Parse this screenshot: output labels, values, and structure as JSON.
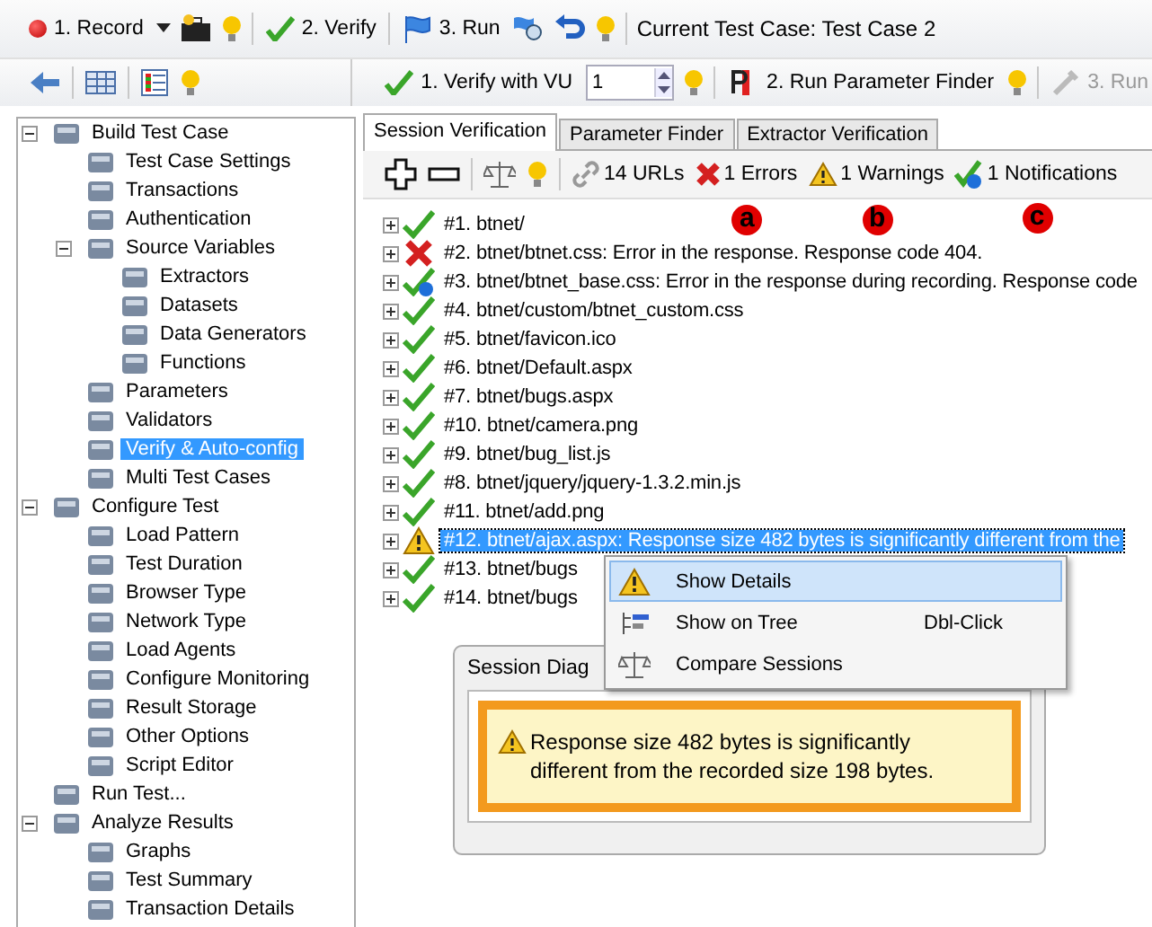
{
  "toolbar_top": {
    "record": "1. Record",
    "verify": "2. Verify",
    "run": "3. Run",
    "current_test_case": "Current Test Case: Test Case 2"
  },
  "toolbar_second": {
    "verify_vu": "1. Verify with VU",
    "vu_count": "1",
    "run_parameter_finder": "2. Run Parameter Finder",
    "run_disabled": "3. Run"
  },
  "sidebar": {
    "items": [
      {
        "label": "Build Test Case",
        "selected": false,
        "expanded": true,
        "children": [
          {
            "label": "Test Case Settings",
            "selected": false
          },
          {
            "label": "Transactions",
            "selected": false
          },
          {
            "label": "Authentication",
            "selected": false
          },
          {
            "label": "Source Variables",
            "selected": false,
            "expanded": true,
            "children": [
              {
                "label": "Extractors",
                "selected": false
              },
              {
                "label": "Datasets",
                "selected": false
              },
              {
                "label": "Data Generators",
                "selected": false
              },
              {
                "label": "Functions",
                "selected": false
              }
            ]
          },
          {
            "label": "Parameters",
            "selected": false
          },
          {
            "label": "Validators",
            "selected": false
          },
          {
            "label": "Verify & Auto-config",
            "selected": true
          },
          {
            "label": "Multi Test Cases",
            "selected": false
          }
        ]
      },
      {
        "label": "Configure Test",
        "selected": false,
        "expanded": true,
        "children": [
          {
            "label": "Load Pattern",
            "selected": false
          },
          {
            "label": "Test Duration",
            "selected": false
          },
          {
            "label": "Browser Type",
            "selected": false
          },
          {
            "label": "Network Type",
            "selected": false
          },
          {
            "label": "Load Agents",
            "selected": false
          },
          {
            "label": "Configure Monitoring",
            "selected": false
          },
          {
            "label": "Result Storage",
            "selected": false
          },
          {
            "label": "Other Options",
            "selected": false
          },
          {
            "label": "Script Editor",
            "selected": false
          }
        ]
      },
      {
        "label": "Run Test...",
        "selected": false
      },
      {
        "label": "Analyze Results",
        "selected": false,
        "expanded": true,
        "children": [
          {
            "label": "Graphs",
            "selected": false
          },
          {
            "label": "Test Summary",
            "selected": false
          },
          {
            "label": "Transaction Details",
            "selected": false
          }
        ]
      }
    ]
  },
  "tabs": [
    {
      "label": "Session Verification",
      "selected": true
    },
    {
      "label": "Parameter Finder",
      "selected": false
    },
    {
      "label": "Extractor Verification",
      "selected": false
    }
  ],
  "summary": {
    "urls": "14 URLs",
    "errors": "1 Errors",
    "warnings": "1 Warnings",
    "notifications": "1 Notifications"
  },
  "annotations": [
    "a",
    "b",
    "c"
  ],
  "sessions": [
    {
      "text": "#1. btnet/",
      "kind": "ok",
      "selected": false
    },
    {
      "text": "#2. btnet/btnet.css: Error in the response. Response code 404.",
      "kind": "error",
      "selected": false
    },
    {
      "text": "#3. btnet/btnet_base.css: Error in the response during recording. Response code",
      "kind": "info",
      "selected": false
    },
    {
      "text": "#4. btnet/custom/btnet_custom.css",
      "kind": "ok",
      "selected": false
    },
    {
      "text": "#5. btnet/favicon.ico",
      "kind": "ok",
      "selected": false
    },
    {
      "text": "#6. btnet/Default.aspx",
      "kind": "ok",
      "selected": false
    },
    {
      "text": "#7. btnet/bugs.aspx",
      "kind": "ok",
      "selected": false
    },
    {
      "text": "#10. btnet/camera.png",
      "kind": "ok",
      "selected": false
    },
    {
      "text": "#9. btnet/bug_list.js",
      "kind": "ok",
      "selected": false
    },
    {
      "text": "#8. btnet/jquery/jquery-1.3.2.min.js",
      "kind": "ok",
      "selected": false
    },
    {
      "text": "#11. btnet/add.png",
      "kind": "ok",
      "selected": false
    },
    {
      "text": "#12. btnet/ajax.aspx: Response size 482 bytes is significantly different from the",
      "kind": "warning",
      "selected": true
    },
    {
      "text": "#13. btnet/bugs",
      "kind": "ok",
      "selected": false
    },
    {
      "text": "#14. btnet/bugs",
      "kind": "ok",
      "selected": false
    }
  ],
  "context_menu": [
    {
      "label": "Show Details",
      "kind": "warning",
      "selected": true
    },
    {
      "label": "Show on Tree",
      "shortcut": "Dbl-Click",
      "kind": "tree",
      "selected": false
    },
    {
      "label": "Compare Sessions",
      "kind": "scale",
      "selected": false
    }
  ],
  "dialog": {
    "title": "Session Diag",
    "message": "Response size 482 bytes is significantly different from the recorded size 198 bytes."
  }
}
